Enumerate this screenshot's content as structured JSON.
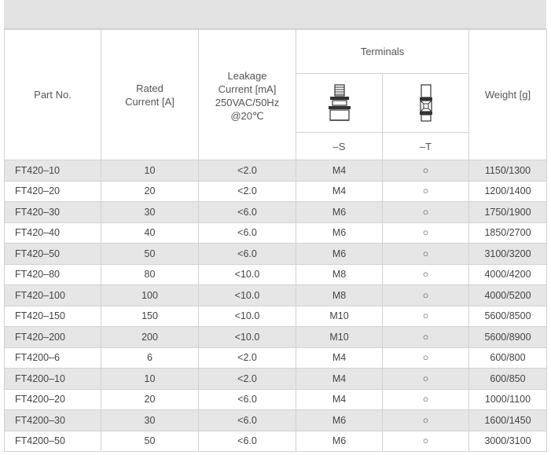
{
  "headers": {
    "part_no": "Part No.",
    "rated_current": [
      "Rated",
      "Current [A]"
    ],
    "leakage_current": [
      "Leakage",
      "Current [mA]",
      "250VAC/50Hz",
      "@20℃"
    ],
    "terminals": "Terminals",
    "terminal_s": "–S",
    "terminal_t": "–T",
    "weight": "Weight [g]"
  },
  "icons": {
    "terminal_s_icon": "stud-bolt-terminal-icon",
    "terminal_t_icon": "faston-tab-terminal-icon",
    "available": "circle-icon"
  },
  "rows": [
    {
      "part": "FT420–10",
      "current": "10",
      "leakage": "<2.0",
      "s": "M4",
      "t": "○",
      "weight": "1150/1300"
    },
    {
      "part": "FT420–20",
      "current": "20",
      "leakage": "<2.0",
      "s": "M4",
      "t": "○",
      "weight": "1200/1400"
    },
    {
      "part": "FT420–30",
      "current": "30",
      "leakage": "<6.0",
      "s": "M6",
      "t": "○",
      "weight": "1750/1900"
    },
    {
      "part": "FT420–40",
      "current": "40",
      "leakage": "<6.0",
      "s": "M6",
      "t": "○",
      "weight": "1850/2700"
    },
    {
      "part": "FT420–50",
      "current": "50",
      "leakage": "<6.0",
      "s": "M6",
      "t": "○",
      "weight": "3100/3200"
    },
    {
      "part": "FT420–80",
      "current": "80",
      "leakage": "<10.0",
      "s": "M8",
      "t": "○",
      "weight": "4000/4200"
    },
    {
      "part": "FT420–100",
      "current": "100",
      "leakage": "<10.0",
      "s": "M8",
      "t": "○",
      "weight": "4000/5200"
    },
    {
      "part": "FT420–150",
      "current": "150",
      "leakage": "<10.0",
      "s": "M10",
      "t": "○",
      "weight": "5600/8500"
    },
    {
      "part": "FT420–200",
      "current": "200",
      "leakage": "<10.0",
      "s": "M10",
      "t": "○",
      "weight": "5600/8900"
    },
    {
      "part": "FT4200–6",
      "current": "6",
      "leakage": "<2.0",
      "s": "M4",
      "t": "○",
      "weight": "600/800"
    },
    {
      "part": "FT4200–10",
      "current": "10",
      "leakage": "<2.0",
      "s": "M4",
      "t": "○",
      "weight": "600/850"
    },
    {
      "part": "FT4200–20",
      "current": "20",
      "leakage": "<6.0",
      "s": "M4",
      "t": "○",
      "weight": "1000/1100"
    },
    {
      "part": "FT4200–30",
      "current": "30",
      "leakage": "<6.0",
      "s": "M6",
      "t": "○",
      "weight": "1600/1450"
    },
    {
      "part": "FT4200–50",
      "current": "50",
      "leakage": "<6.0",
      "s": "M6",
      "t": "○",
      "weight": "3000/3100"
    }
  ]
}
